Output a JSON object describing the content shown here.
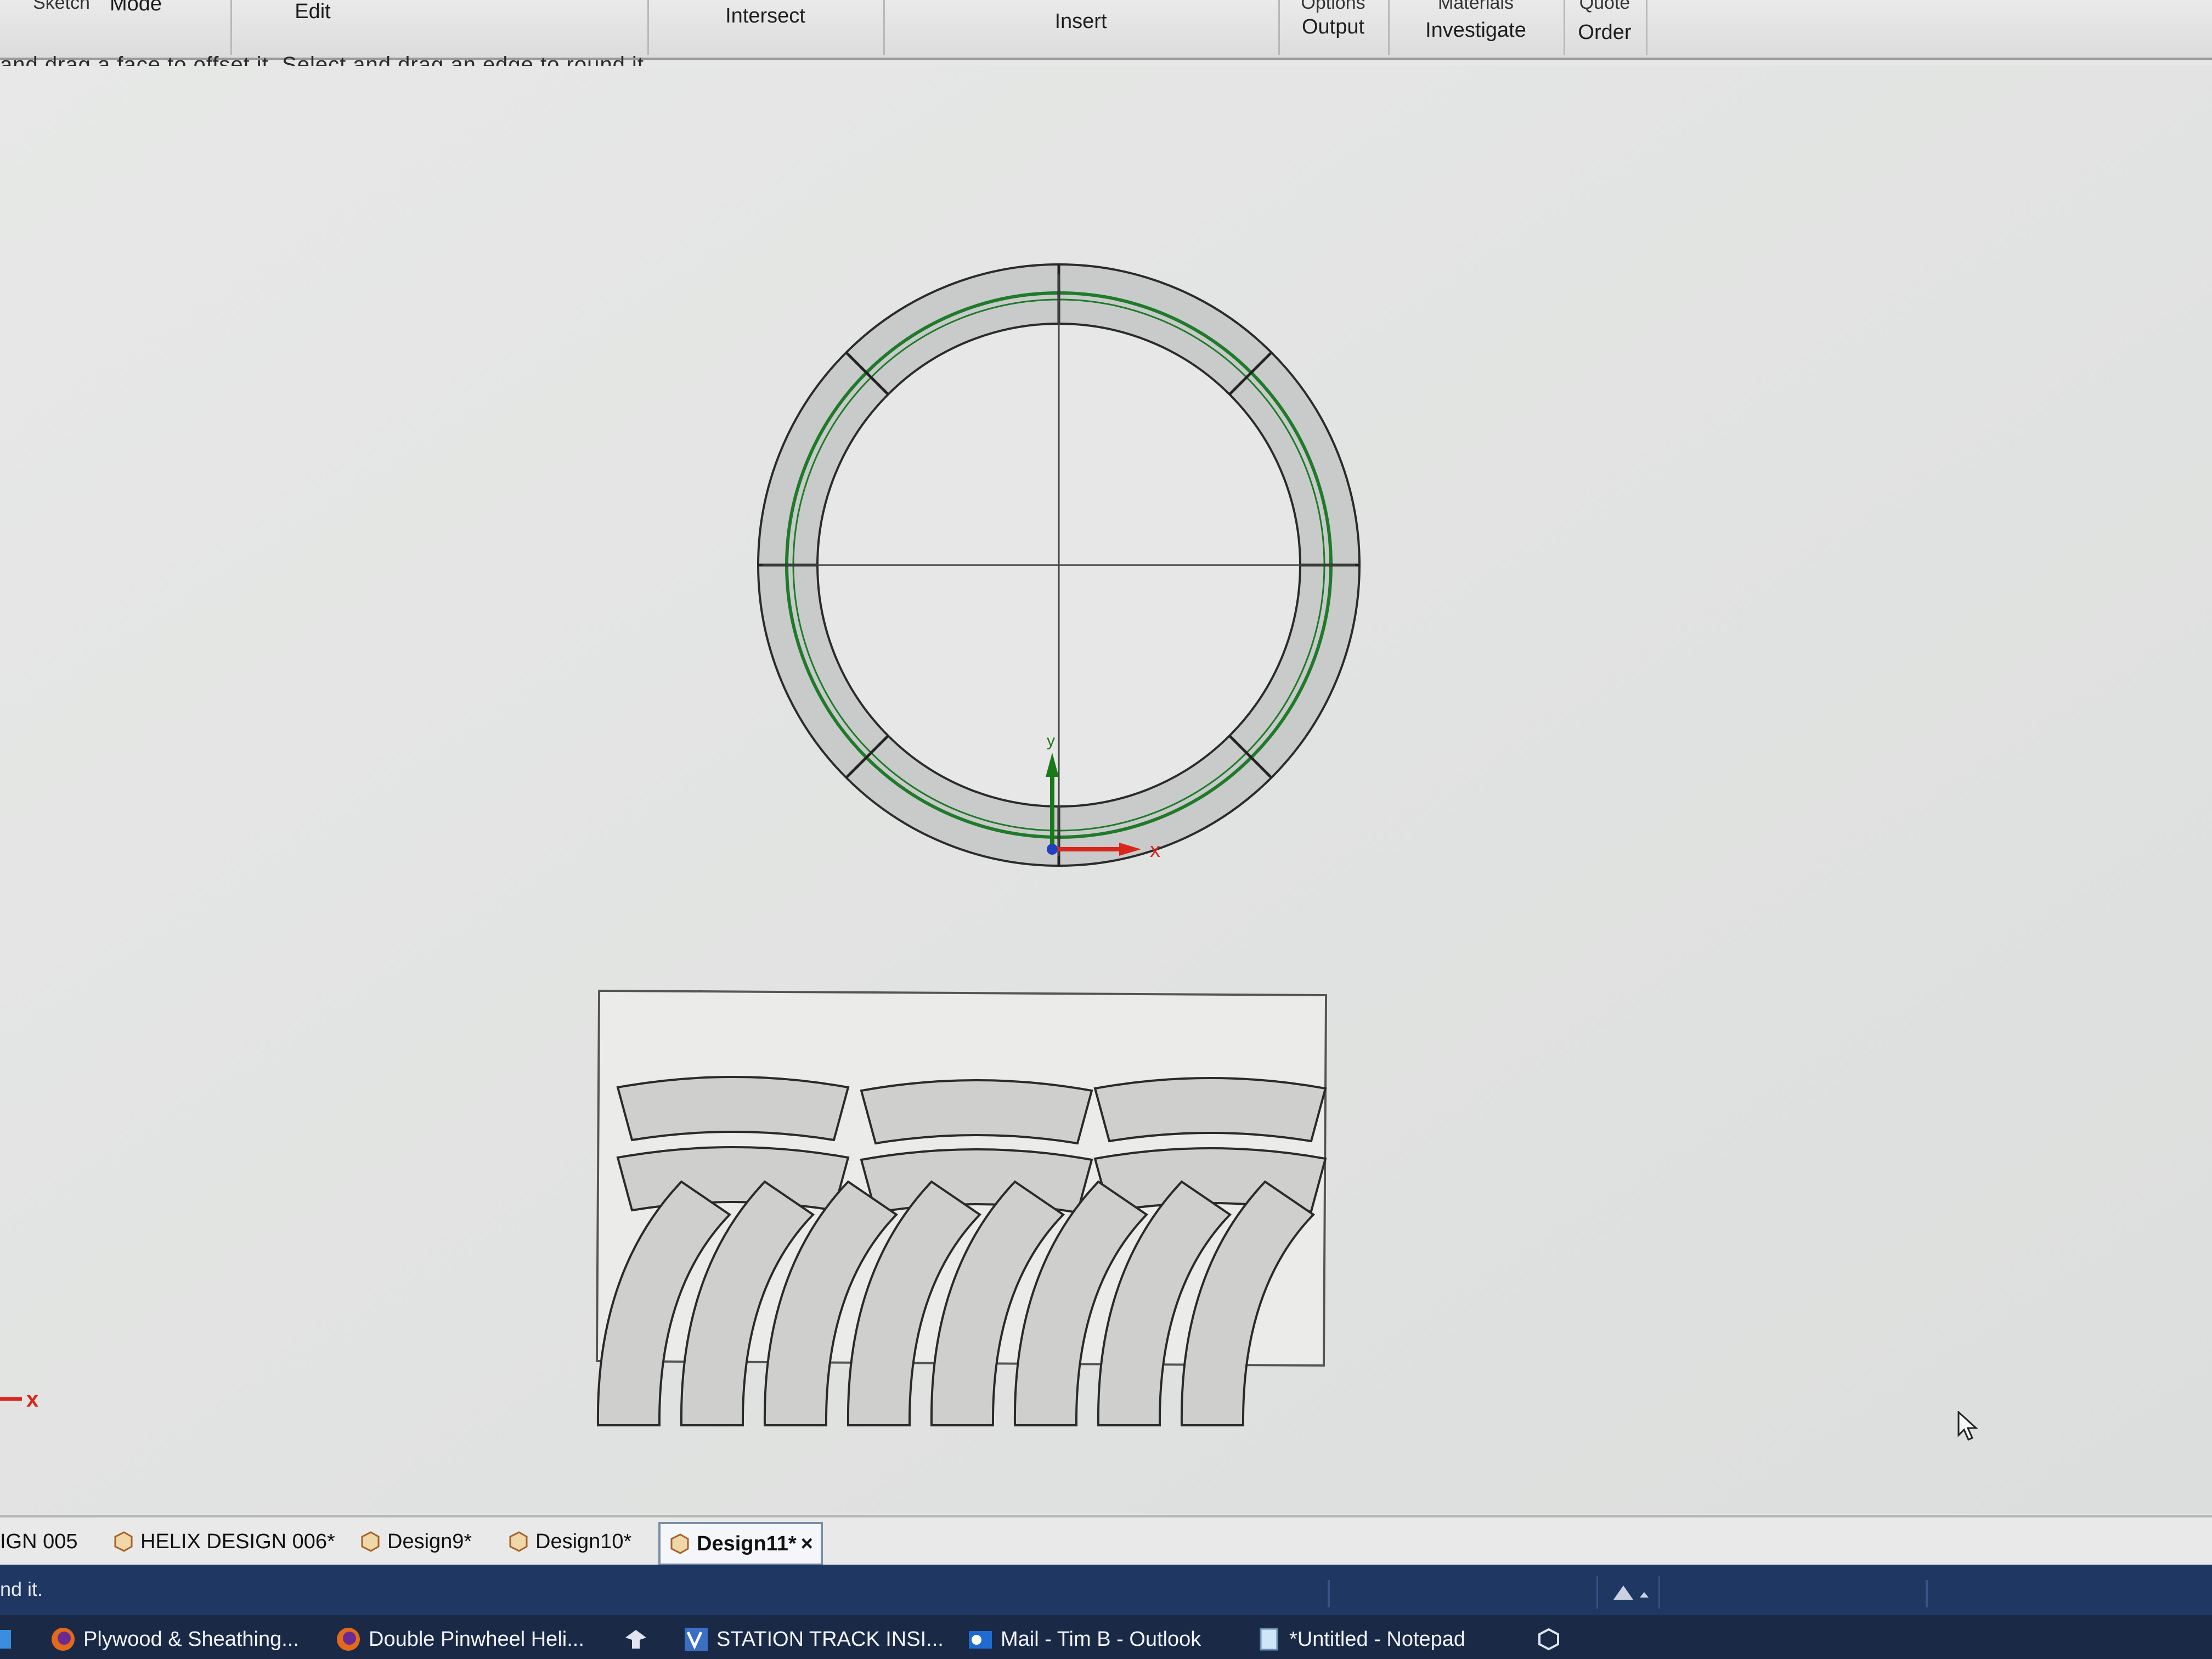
{
  "ribbon": {
    "groups": {
      "sketch": "Sketch",
      "mode": "Mode",
      "edit": "Edit",
      "intersect": "Intersect",
      "insert": "Insert",
      "options_output_top": "Options",
      "output": "Output",
      "materials_top": "Materials",
      "investigate": "Investigate",
      "quote_top": "Quote",
      "order": "Order"
    }
  },
  "hint_text": "and drag a face to offset it. Select and drag an edge to round it.",
  "canvas": {
    "axis_x_label": "x",
    "axis_y_label": "y",
    "corner_axis_label": "x"
  },
  "doc_tabs": [
    {
      "label": "IGN 005"
    },
    {
      "label": "HELIX DESIGN 006*"
    },
    {
      "label": "Design9*"
    },
    {
      "label": "Design10*"
    },
    {
      "label": "Design11*",
      "close": "×"
    }
  ],
  "status": {
    "message": "nd it."
  },
  "taskbar": [
    {
      "label": "Plywood & Sheathing..."
    },
    {
      "label": "Double Pinwheel Heli..."
    },
    {
      "label": "STATION TRACK INSI..."
    },
    {
      "label": "Mail - Tim B - Outlook"
    },
    {
      "label": "*Untitled - Notepad"
    }
  ],
  "colors": {
    "ring_green": "#1f7a2a",
    "axis_red": "#d8271c",
    "axis_green": "#1a7a1a",
    "status_blue": "#1f3763"
  }
}
